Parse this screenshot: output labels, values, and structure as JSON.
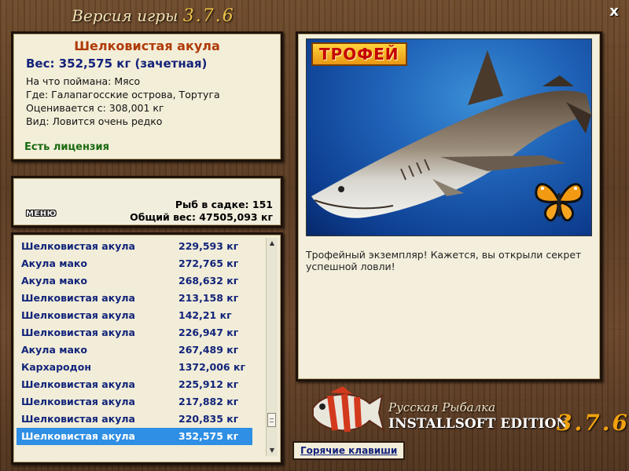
{
  "window": {
    "title_prefix": "Версия игры",
    "title_version": "3.7.6",
    "close_label": "x"
  },
  "catch": {
    "name": "Шелковистая акула",
    "weight_line": "Вес: 352,575 кг (зачетная)",
    "bait": "На что поймана: Мясо",
    "location": "Где: Галапагосские острова, Тортуга",
    "valued_from": "Оценивается с: 308,001 кг",
    "rarity": "Вид: Ловится очень редко",
    "license": "Есть лицензия"
  },
  "stats": {
    "fish_in_cage": "Рыб в садке: 151",
    "total_weight": "Общий вес: 47505,093 кг",
    "menu_label": "МЕНЮ"
  },
  "fish_list": {
    "selected_index": 11,
    "scroll_position": 0.9,
    "items": [
      {
        "name": "Шелковистая акула",
        "weight": "229,593 кг"
      },
      {
        "name": "Акула мако",
        "weight": "272,765 кг"
      },
      {
        "name": "Акула мако",
        "weight": "268,632 кг"
      },
      {
        "name": "Шелковистая акула",
        "weight": "213,158 кг"
      },
      {
        "name": "Шелковистая акула",
        "weight": "142,21 кг"
      },
      {
        "name": "Шелковистая акула",
        "weight": "226,947 кг"
      },
      {
        "name": "Акула мако",
        "weight": "267,489 кг"
      },
      {
        "name": "Кархародон",
        "weight": "1372,006 кг"
      },
      {
        "name": "Шелковистая акула",
        "weight": "225,912 кг"
      },
      {
        "name": "Шелковистая акула",
        "weight": "217,882 кг"
      },
      {
        "name": "Шелковистая акула",
        "weight": "220,835 кг"
      },
      {
        "name": "Шелковистая акула",
        "weight": "352,575 кг"
      }
    ]
  },
  "trophy": {
    "badge": "ТРОФЕЙ",
    "description": "Трофейный экземпляр! Кажется, вы открыли секрет успешной ловли!"
  },
  "footer": {
    "hotkeys_label": "Горячие клавиши",
    "brand_line1": "Русская Рыбалка",
    "brand_line2": "INSTALLSOFT EDITION",
    "brand_version": "3.7.6"
  },
  "colors": {
    "title_text": "#f3e2b4",
    "version_gold": "#f0c24a",
    "fish_name_orange": "#b03a07",
    "weight_blue": "#14227a",
    "license_green": "#1a6a11",
    "selection_blue": "#2f8fe4"
  }
}
